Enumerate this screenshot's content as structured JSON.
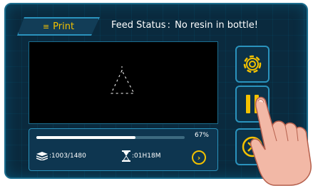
{
  "header": {
    "tab_label": "Print",
    "feed_status_label": "Feed Status",
    "feed_status_separator": ":",
    "feed_status_value": "No resin in bottle!"
  },
  "progress": {
    "percent_text": "67%",
    "fraction": 0.67
  },
  "stats": {
    "layers_text": ":1003/1480",
    "time_text": ":01H18M"
  },
  "colors": {
    "accent": "#f2c100",
    "panel_border": "#2a93bd",
    "background": "#0a2a3e"
  },
  "icons": {
    "tab_icon": "menu-icon",
    "layers_icon": "layers-icon",
    "time_icon": "hourglass-icon",
    "next_icon": "chevron-right-icon",
    "settings_icon": "gear-icon",
    "pause_icon": "pause-icon",
    "stop_icon": "close-circle-icon"
  }
}
